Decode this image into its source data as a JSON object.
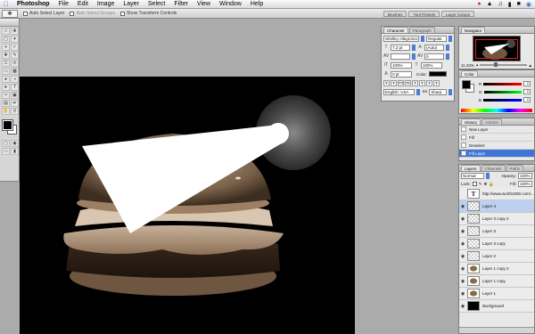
{
  "menubar": {
    "items": [
      "Photoshop",
      "File",
      "Edit",
      "Image",
      "Layer",
      "Select",
      "Filter",
      "View",
      "Window",
      "Help"
    ]
  },
  "options": {
    "auto_select_layer": "Auto Select Layer",
    "auto_select_groups": "Auto Select Groups",
    "show_transform_controls": "Show Transform Controls",
    "wells": [
      "Brushes",
      "Tool Presets",
      "Layer Comps"
    ]
  },
  "character": {
    "tabs": [
      "Character",
      "Paragraph"
    ],
    "font_family": "Shelley AllegroScr...",
    "font_style": "Regular",
    "font_size": "7.2 pt",
    "leading": "(Auto)",
    "tracking": "0",
    "vertical_scale": "100%",
    "horizontal_scale": "100%",
    "baseline_shift": "0 pt",
    "color_label": "Color:",
    "language": "English: USA",
    "antialias": "Sharp",
    "format_buttons": [
      "T",
      "T",
      "TT",
      "Tt",
      "T",
      "T",
      "T",
      "T"
    ]
  },
  "navigator": {
    "tabs": [
      "Navigator"
    ],
    "zoom": "11.33%"
  },
  "color": {
    "tabs": [
      "Color"
    ],
    "rows": [
      {
        "label": "R",
        "value": "0"
      },
      {
        "label": "G",
        "value": "0"
      },
      {
        "label": "B",
        "value": "0"
      }
    ]
  },
  "history": {
    "tabs": [
      "History",
      "Actions"
    ],
    "items": [
      "New Layer",
      "Fill",
      "Deselect",
      "Fill Layer"
    ],
    "selected_index": 3
  },
  "layers": {
    "tabs": [
      "Layers",
      "Channels",
      "Paths"
    ],
    "blend_mode": "Normal",
    "opacity_label": "Opacity:",
    "opacity": "100%",
    "lock_label": "Lock:",
    "fill_label": "Fill:",
    "fill": "100%",
    "items": [
      {
        "name": "http://www.worth1000.com/...",
        "thumb": "text"
      },
      {
        "name": "Layer 4",
        "thumb": "checker",
        "selected": true
      },
      {
        "name": "Layer 3 copy 2",
        "thumb": "checker"
      },
      {
        "name": "Layer 3",
        "thumb": "checker"
      },
      {
        "name": "Layer 3 copy",
        "thumb": "checker"
      },
      {
        "name": "Layer 2",
        "thumb": "checker"
      },
      {
        "name": "Layer 1 copy 2",
        "thumb": "burger"
      },
      {
        "name": "Layer 1 copy",
        "thumb": "burger"
      },
      {
        "name": "Layer 1",
        "thumb": "burger"
      },
      {
        "name": "Background",
        "thumb": "black"
      }
    ]
  },
  "colors": {
    "accent": "#3f75d6",
    "canvas_bg": "#000000",
    "workspace": "#ababab"
  }
}
